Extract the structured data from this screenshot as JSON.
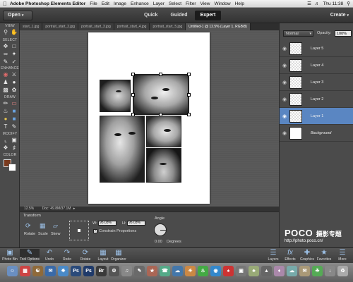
{
  "menubar": {
    "app_name": "Adobe Photoshop Elements Editor",
    "items": [
      "File",
      "Edit",
      "Image",
      "Enhance",
      "Layer",
      "Select",
      "Filter",
      "View",
      "Window",
      "Help"
    ],
    "clock": "Thu 11:38"
  },
  "topbar": {
    "open_label": "Open",
    "modes": [
      "Quick",
      "Guided",
      "Expert"
    ],
    "active_mode": "Expert",
    "create_label": "Create"
  },
  "tools": {
    "sections": [
      "VIEW",
      "SELECT",
      "ENHANCE",
      "DRAW",
      "MODIFY",
      "COLOR"
    ]
  },
  "doc_tabs": [
    "start_1.jpg",
    "portrait_start_2.jpg",
    "portrait_start_3.jpg",
    "portrait_start_4.jpg",
    "portrait_start_5.jpg",
    "Untitled-1 @ 12.5% (Layer 1, RGB/8)"
  ],
  "status": {
    "zoom": "12.5%",
    "doc_size": "Doc: 49.8M/37.1M"
  },
  "options": {
    "title": "Transform",
    "buttons": [
      "Rotate",
      "Scale",
      "Skew"
    ],
    "w_label": "W:",
    "w_value": "95.03%",
    "h_label": "H:",
    "h_value": "95.03%",
    "constrain_label": "Constrain Proportions",
    "angle_label": "Angle",
    "angle_value": "0.00",
    "degrees_label": "Degrees"
  },
  "layers": {
    "blend_mode": "Normal",
    "opacity_label": "Opacity:",
    "opacity_value": "100%",
    "items": [
      {
        "name": "Layer 5"
      },
      {
        "name": "Layer 4"
      },
      {
        "name": "Layer 3"
      },
      {
        "name": "Layer 2"
      },
      {
        "name": "Layer 1"
      },
      {
        "name": "Background"
      }
    ],
    "selected": "Layer 1"
  },
  "bottombar": {
    "left": [
      "Photo Bin",
      "Tool Options",
      "Undo",
      "Redo",
      "Rotate",
      "Layout",
      "Organizer"
    ],
    "right": [
      "Layers",
      "Effects",
      "Graphics",
      "Favorites",
      "More"
    ]
  },
  "watermark": {
    "brand": "POCO",
    "cn": "摄影专题",
    "url": "http://photo.poco.cn/"
  },
  "colors": {
    "accent": "#5a86c2",
    "panel": "#4b4b4b",
    "canvas_bg": "#5a5a5a"
  }
}
